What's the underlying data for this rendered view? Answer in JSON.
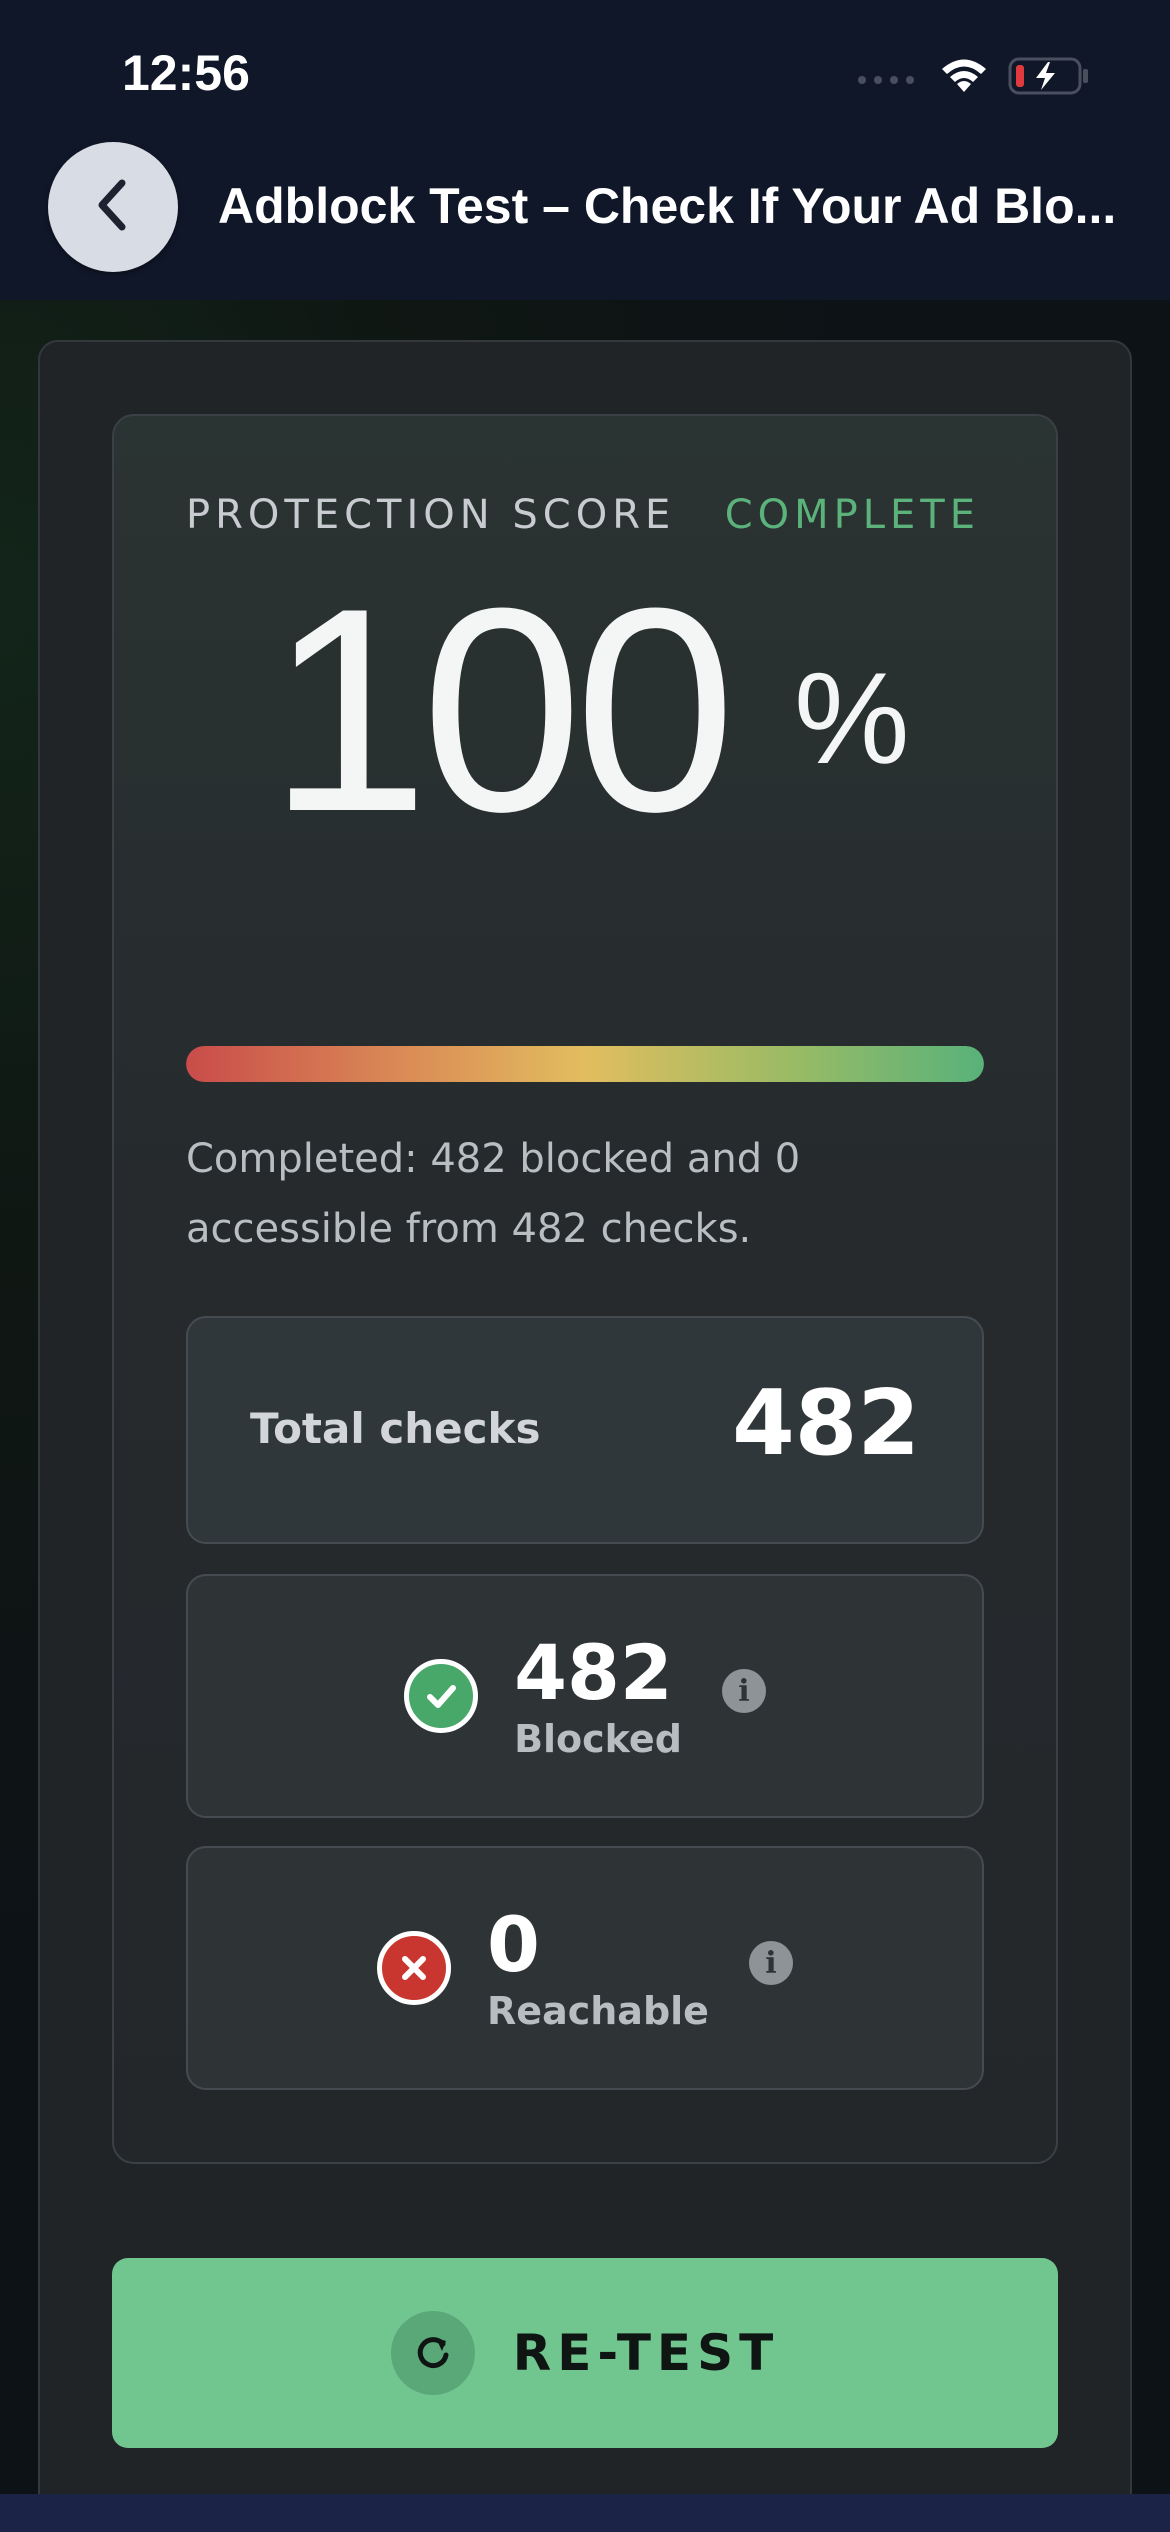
{
  "status_bar": {
    "time": "12:56",
    "icons": [
      "signal-icon",
      "wifi-icon",
      "battery-charging-icon"
    ]
  },
  "header": {
    "title": "Adblock Test – Check If Your Ad Blo..."
  },
  "score_card": {
    "label": "PROTECTION SCORE",
    "status": "COMPLETE",
    "score": "100",
    "unit": "%",
    "progress_percent": 100,
    "summary": "Completed: 482 blocked and 0 accessible from 482 checks."
  },
  "stats": {
    "total_label": "Total checks",
    "total_value": "482",
    "blocked_value": "482",
    "blocked_label": "Blocked",
    "reachable_value": "0",
    "reachable_label": "Reachable",
    "info_glyph": "i"
  },
  "actions": {
    "retest_label": "RE-TEST"
  },
  "colors": {
    "accent_green": "#71c690",
    "complete_green": "#5bb27a",
    "blocked_icon": "#48a86a",
    "reachable_icon": "#c8362f"
  }
}
